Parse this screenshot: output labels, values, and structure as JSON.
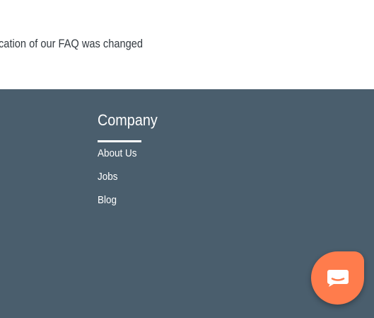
{
  "notice": {
    "text": "cation of our FAQ was changed"
  },
  "footer": {
    "heading": "Company",
    "links": [
      {
        "label": "About Us"
      },
      {
        "label": "Jobs"
      },
      {
        "label": "Blog"
      }
    ]
  },
  "chat_widget": {
    "icon": "chat-bubble-icon",
    "color": "#ff7c4c"
  },
  "colors": {
    "footer_background": "#4a5e6d",
    "text_on_footer": "#ffffff",
    "body_text": "#333a40"
  }
}
